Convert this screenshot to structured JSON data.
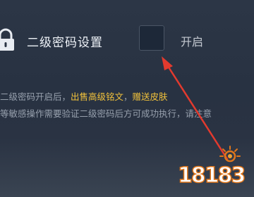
{
  "setting": {
    "lock_icon": "lock-icon",
    "title": "二级密码设置",
    "toggle_label": "开启",
    "toggle_checked": false
  },
  "description": {
    "line1_prefix": "二级密码开启后，",
    "line1_highlight1": "出售高级铭文",
    "line1_separator": "，",
    "line1_highlight2": "赠送皮肤",
    "line2": "等敏感操作需要验证二级密码后方可成功执行，请注意"
  },
  "watermark": {
    "text": "18183",
    "icon": "sun-icon"
  },
  "colors": {
    "background": "#2a3444",
    "title_text": "#eef2f7",
    "toggle_fill": "#1d2838",
    "highlight": "#f3c33b",
    "annotation_arrow": "#e23a2e",
    "watermark_orange": "#e0761a"
  }
}
